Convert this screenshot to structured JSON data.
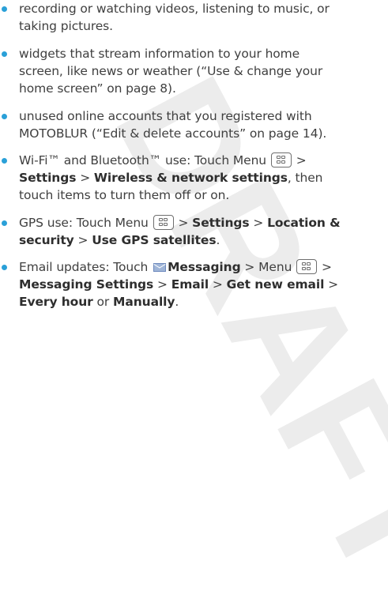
{
  "watermark": "DRAFT",
  "colors": {
    "bullet": "#2aa0d8",
    "text": "#3f3f3f",
    "watermark": "#ececec"
  },
  "items": [
    {
      "lines": [
        "recording or watching videos, listening to music, or",
        "taking pictures."
      ]
    },
    {
      "lines": [
        "widgets that stream information to your home",
        "screen, like news or weather (“Use & change your",
        "home screen” on page 8)."
      ]
    },
    {
      "lines": [
        "unused online accounts that you registered with",
        "MOTOBLUR (“Edit & delete accounts” on page 14)."
      ]
    },
    {
      "l1_a": "Wi-Fi™ and Bluetooth™ use: Touch Menu",
      "l1_b": ">",
      "settings": "Settings",
      "sep": ">",
      "wireless": "Wireless & network settings",
      "l2_c": ", then",
      "l3": "touch items to turn them off or on."
    },
    {
      "l1_a": "GPS use: Touch Menu",
      "l1_b": ">",
      "settings": "Settings",
      "sep1": ">",
      "location": "Location &",
      "security": "security",
      "sep2": ">",
      "use_gps": "Use GPS satellites",
      "end": "."
    },
    {
      "l1_a": "Email updates: Touch",
      "messaging": "Messaging",
      "l1_b": "> Menu",
      "l1_c": ">",
      "messaging_settings": "Messaging Settings",
      "sep1": ">",
      "email": "Email",
      "sep2": ">",
      "get_new_email": "Get new email",
      "sep3": ">",
      "every_hour": "Every hour",
      "or": "or",
      "manually": "Manually",
      "end": "."
    }
  ],
  "icons": [
    "bullet-icon",
    "menu-icon",
    "mail-icon"
  ]
}
